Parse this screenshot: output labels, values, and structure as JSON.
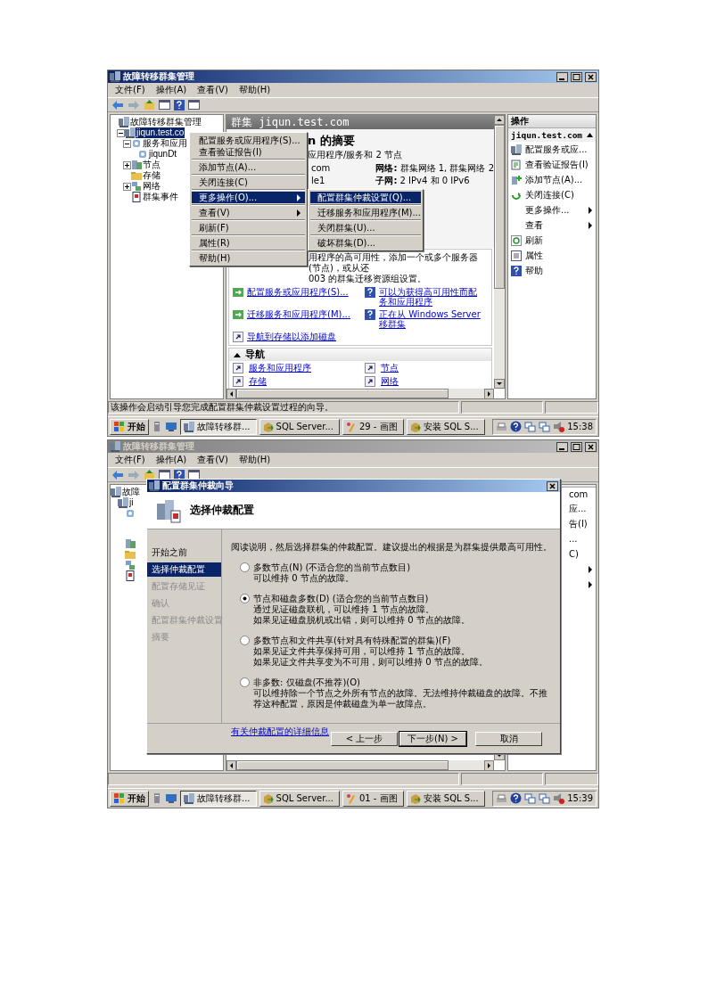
{
  "screenshot_1": {
    "window": {
      "title": "故障转移群集管理",
      "active": true
    },
    "menu": [
      "文件(F)",
      "操作(A)",
      "查看(V)",
      "帮助(H)"
    ],
    "tree": [
      {
        "label": "故障转移群集管理",
        "selected": false,
        "children": [
          {
            "label": "jiqun.test.co",
            "selected": true,
            "expanded": true,
            "children": [
              {
                "label": "服务和应用",
                "selected": false,
                "expanded": true,
                "children": [
                  {
                    "label": "jiqunDt",
                    "selected": false
                  }
                ]
              },
              {
                "label": "节点",
                "selected": false,
                "expanded": false
              },
              {
                "label": "存储",
                "selected": false
              },
              {
                "label": "网络",
                "selected": false,
                "expanded": false
              },
              {
                "label": "群集事件",
                "selected": false
              }
            ]
          }
        ]
      }
    ],
    "center": {
      "header": "群集 jiqun.test.com",
      "summary_title": "n 的摘要",
      "summary_sub": "应用程序/服务和 2 节点",
      "details_left": [
        "com",
        "le1"
      ],
      "details_right": [
        {
          "label": "网络:",
          "value": "群集网络 1, 群集网络 2"
        },
        {
          "label": "子网:",
          "value": "2 IPv4 和 0 IPv6"
        }
      ],
      "config_text": [
        "用程序的高可用性，添加一个或多个服务器(节点)，或从还",
        "003 的群集迁移资源组设置。"
      ],
      "config_links": [
        {
          "kind": "action",
          "lines": [
            "配置服务或应用程序(S)..."
          ]
        },
        {
          "kind": "help",
          "lines": [
            "可以为获得高可用性而配",
            "务和应用程序"
          ]
        },
        {
          "kind": "action",
          "lines": [
            "迁移服务和应用程序(M)..."
          ]
        },
        {
          "kind": "help",
          "lines": [
            "正在从 Windows Server",
            "移群集"
          ]
        },
        {
          "kind": "nav",
          "lines": [
            "导航到存储以添加磁盘"
          ]
        }
      ],
      "nav_title": "导航",
      "nav_expanded": true,
      "nav_links": [
        "服务和应用程序",
        "节点",
        "存储",
        "网络"
      ]
    },
    "actions": {
      "title": "操作",
      "group": "jiqun.test.com",
      "expanded": true,
      "items": [
        {
          "label": "配置服务或应...",
          "submenu": false
        },
        {
          "label": "查看验证报告(I)",
          "submenu": false
        },
        {
          "label": "添加节点(A)...",
          "submenu": false
        },
        {
          "label": "关闭连接(C)",
          "submenu": false
        },
        {
          "label": "更多操作...",
          "submenu": true
        },
        {
          "label": "查看",
          "submenu": true
        },
        {
          "label": "刷新",
          "submenu": false
        },
        {
          "label": "属性",
          "submenu": false
        },
        {
          "label": "帮助",
          "submenu": false
        }
      ]
    },
    "status": "该操作会启动引导您完成配置群集仲裁设置过程的向导。",
    "context_menu": {
      "groups": [
        [
          {
            "label": "配置服务或应用程序(S)...",
            "selected": false,
            "submenu": false
          },
          {
            "label": "查看验证报告(I)",
            "selected": false,
            "submenu": false
          }
        ],
        [
          {
            "label": "添加节点(A)...",
            "selected": false,
            "submenu": false
          }
        ],
        [
          {
            "label": "关闭连接(C)",
            "selected": false,
            "submenu": false
          }
        ],
        [
          {
            "label": "更多操作(O)...",
            "selected": true,
            "submenu": true
          }
        ],
        [
          {
            "label": "查看(V)",
            "selected": false,
            "submenu": true
          }
        ],
        [
          {
            "label": "刷新(F)",
            "selected": false,
            "submenu": false
          }
        ],
        [
          {
            "label": "属性(R)",
            "selected": false,
            "submenu": false
          }
        ],
        [
          {
            "label": "帮助(H)",
            "selected": false,
            "submenu": false
          }
        ]
      ],
      "submenu": [
        {
          "label": "配置群集仲裁设置(Q)...",
          "selected": true
        },
        {
          "label": "迁移服务和应用程序(M)...",
          "selected": false
        },
        {
          "label": "关闭群集(U)...",
          "selected": false
        },
        {
          "label": "破坏群集(D)...",
          "selected": false
        }
      ]
    },
    "taskbar": {
      "start": "开始",
      "tasks": [
        {
          "label": "故障转移群...",
          "selected": true
        },
        {
          "label": "SQL Server...",
          "selected": false
        },
        {
          "label": "29 - 画图",
          "selected": false
        },
        {
          "label": "安装 SQL S...",
          "selected": false
        }
      ],
      "time": "15:38"
    }
  },
  "screenshot_2": {
    "window": {
      "title": "故障转移群集管理",
      "active": false
    },
    "menu": [
      "文件(F)",
      "操作(A)",
      "查看(V)",
      "帮助(H)"
    ],
    "tree_fragments": [
      "故障",
      "ji"
    ],
    "action_fragments": [
      {
        "label": "com",
        "submenu": false
      },
      {
        "label": "应...",
        "submenu": false
      },
      {
        "label": "告(I)",
        "submenu": false
      },
      {
        "label": "...",
        "submenu": false
      },
      {
        "label": "C)",
        "submenu": false
      },
      {
        "submenu": true
      },
      {
        "submenu": true
      }
    ],
    "dialog": {
      "title": "配置群集仲裁向导",
      "heading": "选择仲裁配置",
      "steps": [
        {
          "label": "开始之前",
          "selected": false,
          "disabled": false
        },
        {
          "label": "选择仲裁配置",
          "selected": true,
          "disabled": false
        },
        {
          "label": "配置存储见证",
          "selected": false,
          "disabled": true
        },
        {
          "label": "确认",
          "selected": false,
          "disabled": true
        },
        {
          "label": "配置群集仲裁设置",
          "selected": false,
          "disabled": true
        },
        {
          "label": "摘要",
          "selected": false,
          "disabled": true
        }
      ],
      "intro": "阅读说明，然后选择群集的仲裁配置。建议提出的根据是为群集提供最高可用性。",
      "options": [
        {
          "label": "多数节点(N) (不适合您的当前节点数目)",
          "selected": false,
          "description": [
            "可以维持 0 节点的故障。"
          ]
        },
        {
          "label": "节点和磁盘多数(D) (适合您的当前节点数目)",
          "selected": true,
          "description": [
            "通过见证磁盘联机，可以维持 1 节点的故障。",
            "如果见证磁盘脱机或出错，则可以维持 0 节点的故障。"
          ]
        },
        {
          "label": "多数节点和文件共享(针对具有特殊配置的群集)(F)",
          "selected": false,
          "description": [
            "如果见证文件共享保持可用，可以维持 1 节点的故障。",
            "如果见证文件共享变为不可用，则可以维持 0 节点的故障。"
          ]
        },
        {
          "label": "非多数: 仅磁盘(不推荐)(O)",
          "selected": false,
          "description": [
            "可以维持除一个节点之外所有节点的故障。无法维持仲裁磁盘的故障。不推荐这种配置，原因是仲裁磁盘为单一故障点。"
          ]
        }
      ],
      "link": "有关仲裁配置的详细信息",
      "buttons": [
        {
          "label": "< 上一步",
          "default": false
        },
        {
          "label": "下一步(N) >",
          "default": true
        },
        {
          "label": "取消",
          "default": false
        }
      ]
    },
    "taskbar": {
      "start": "开始",
      "tasks": [
        {
          "label": "故障转移群...",
          "selected": true
        },
        {
          "label": "SQL Server...",
          "selected": false
        },
        {
          "label": "01 - 画图",
          "selected": false
        },
        {
          "label": "安装 SQL S...",
          "selected": false
        }
      ],
      "time": "15:39"
    }
  }
}
